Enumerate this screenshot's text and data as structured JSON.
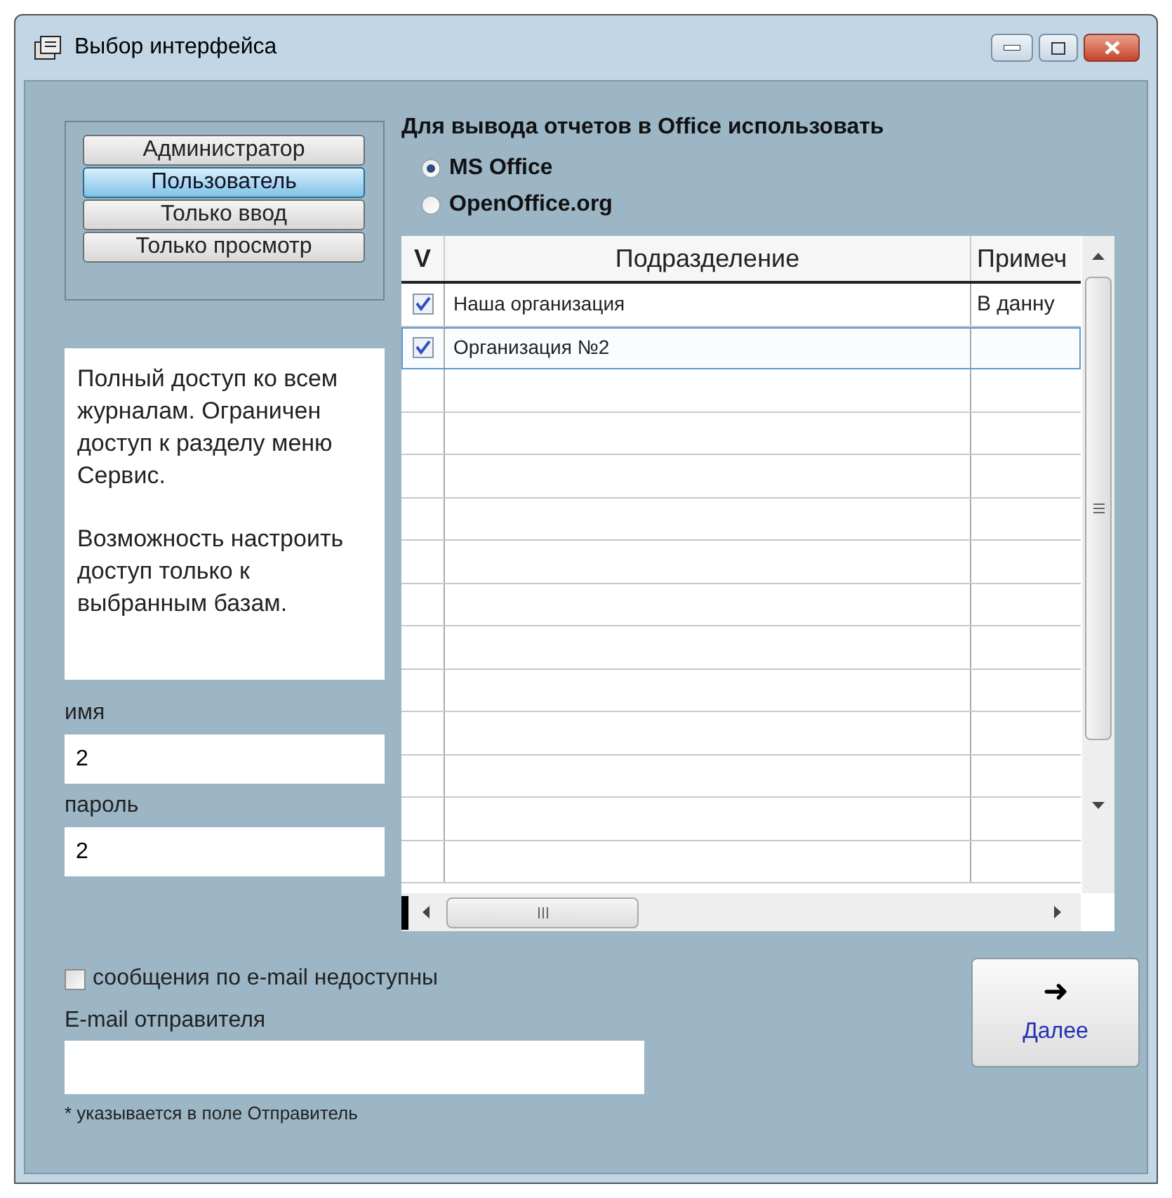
{
  "window": {
    "title": "Выбор интерфейса"
  },
  "roles": [
    {
      "label": "Администратор",
      "selected": false
    },
    {
      "label": "Пользователь",
      "selected": true
    },
    {
      "label": "Только ввод",
      "selected": false
    },
    {
      "label": "Только просмотр",
      "selected": false
    }
  ],
  "description": [
    "Полный доступ ко всем журналам. Ограничен доступ к разделу меню Сервис.",
    "Возможность настроить доступ только к выбранным базам."
  ],
  "login": {
    "name_label": "имя",
    "name_value": "2",
    "password_label": "пароль",
    "password_value": "2"
  },
  "office": {
    "heading": "Для вывода отчетов в Office использовать",
    "options": [
      {
        "label": "MS Office",
        "selected": true
      },
      {
        "label": "OpenOffice.org",
        "selected": false
      }
    ]
  },
  "table": {
    "columns": [
      "V",
      "Подразделение",
      "Примеч"
    ],
    "rows": [
      {
        "checked": true,
        "selected": false,
        "cells": [
          "",
          "Наша организация",
          "В данну"
        ]
      },
      {
        "checked": true,
        "selected": true,
        "cells": [
          "",
          "Организация №2",
          ""
        ]
      }
    ]
  },
  "email": {
    "disabled_label": "сообщения по e-mail недоступны",
    "disabled_checked": false,
    "sender_label": "E-mail отправителя",
    "note": "* указывается в поле Отправитель"
  },
  "next_button": {
    "icon": "➜",
    "label": "Далее"
  }
}
